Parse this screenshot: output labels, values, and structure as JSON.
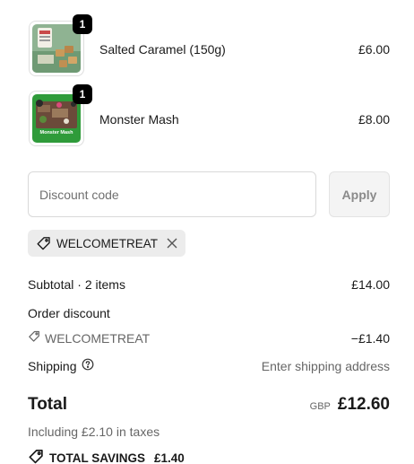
{
  "cart": {
    "items": [
      {
        "name": "Salted Caramel (150g)",
        "quantity": "1",
        "price": "£6.00",
        "image_icon": "salted-caramel-product-image"
      },
      {
        "name": "Monster Mash",
        "quantity": "1",
        "price": "£8.00",
        "image_icon": "monster-mash-product-image",
        "image_label": "Monster Mash"
      }
    ]
  },
  "discount": {
    "placeholder": "Discount code",
    "value": "",
    "apply_label": "Apply",
    "applied_code": "WELCOMETREAT"
  },
  "summary": {
    "subtotal_label": "Subtotal · 2 items",
    "subtotal_value": "£14.00",
    "order_discount_label": "Order discount",
    "discount_code": "WELCOMETREAT",
    "discount_value": "−£1.40",
    "shipping_label": "Shipping",
    "shipping_value": "Enter shipping address",
    "total_label": "Total",
    "currency": "GBP",
    "total_value": "£12.60",
    "taxes_note": "Including £2.10 in taxes",
    "savings_label": "TOTAL SAVINGS",
    "savings_value": "£1.40"
  },
  "colors": {
    "accent": "#000000",
    "muted_text": "#666666",
    "chip_bg": "#ececec",
    "product1_bg": "#7fa783",
    "product2_bg": "#2f9b3a"
  }
}
